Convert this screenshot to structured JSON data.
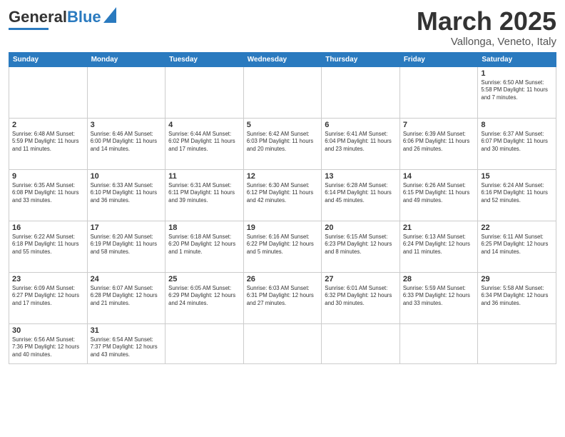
{
  "header": {
    "logo_general": "General",
    "logo_blue": "Blue",
    "month_title": "March 2025",
    "location": "Vallonga, Veneto, Italy"
  },
  "weekdays": [
    "Sunday",
    "Monday",
    "Tuesday",
    "Wednesday",
    "Thursday",
    "Friday",
    "Saturday"
  ],
  "days": [
    {
      "date": "",
      "info": ""
    },
    {
      "date": "",
      "info": ""
    },
    {
      "date": "",
      "info": ""
    },
    {
      "date": "",
      "info": ""
    },
    {
      "date": "",
      "info": ""
    },
    {
      "date": "",
      "info": ""
    },
    {
      "date": "1",
      "info": "Sunrise: 6:50 AM\nSunset: 5:58 PM\nDaylight: 11 hours\nand 7 minutes."
    },
    {
      "date": "2",
      "info": "Sunrise: 6:48 AM\nSunset: 5:59 PM\nDaylight: 11 hours\nand 11 minutes."
    },
    {
      "date": "3",
      "info": "Sunrise: 6:46 AM\nSunset: 6:00 PM\nDaylight: 11 hours\nand 14 minutes."
    },
    {
      "date": "4",
      "info": "Sunrise: 6:44 AM\nSunset: 6:02 PM\nDaylight: 11 hours\nand 17 minutes."
    },
    {
      "date": "5",
      "info": "Sunrise: 6:42 AM\nSunset: 6:03 PM\nDaylight: 11 hours\nand 20 minutes."
    },
    {
      "date": "6",
      "info": "Sunrise: 6:41 AM\nSunset: 6:04 PM\nDaylight: 11 hours\nand 23 minutes."
    },
    {
      "date": "7",
      "info": "Sunrise: 6:39 AM\nSunset: 6:06 PM\nDaylight: 11 hours\nand 26 minutes."
    },
    {
      "date": "8",
      "info": "Sunrise: 6:37 AM\nSunset: 6:07 PM\nDaylight: 11 hours\nand 30 minutes."
    },
    {
      "date": "9",
      "info": "Sunrise: 6:35 AM\nSunset: 6:08 PM\nDaylight: 11 hours\nand 33 minutes."
    },
    {
      "date": "10",
      "info": "Sunrise: 6:33 AM\nSunset: 6:10 PM\nDaylight: 11 hours\nand 36 minutes."
    },
    {
      "date": "11",
      "info": "Sunrise: 6:31 AM\nSunset: 6:11 PM\nDaylight: 11 hours\nand 39 minutes."
    },
    {
      "date": "12",
      "info": "Sunrise: 6:30 AM\nSunset: 6:12 PM\nDaylight: 11 hours\nand 42 minutes."
    },
    {
      "date": "13",
      "info": "Sunrise: 6:28 AM\nSunset: 6:14 PM\nDaylight: 11 hours\nand 45 minutes."
    },
    {
      "date": "14",
      "info": "Sunrise: 6:26 AM\nSunset: 6:15 PM\nDaylight: 11 hours\nand 49 minutes."
    },
    {
      "date": "15",
      "info": "Sunrise: 6:24 AM\nSunset: 6:16 PM\nDaylight: 11 hours\nand 52 minutes."
    },
    {
      "date": "16",
      "info": "Sunrise: 6:22 AM\nSunset: 6:18 PM\nDaylight: 11 hours\nand 55 minutes."
    },
    {
      "date": "17",
      "info": "Sunrise: 6:20 AM\nSunset: 6:19 PM\nDaylight: 11 hours\nand 58 minutes."
    },
    {
      "date": "18",
      "info": "Sunrise: 6:18 AM\nSunset: 6:20 PM\nDaylight: 12 hours\nand 1 minute."
    },
    {
      "date": "19",
      "info": "Sunrise: 6:16 AM\nSunset: 6:22 PM\nDaylight: 12 hours\nand 5 minutes."
    },
    {
      "date": "20",
      "info": "Sunrise: 6:15 AM\nSunset: 6:23 PM\nDaylight: 12 hours\nand 8 minutes."
    },
    {
      "date": "21",
      "info": "Sunrise: 6:13 AM\nSunset: 6:24 PM\nDaylight: 12 hours\nand 11 minutes."
    },
    {
      "date": "22",
      "info": "Sunrise: 6:11 AM\nSunset: 6:25 PM\nDaylight: 12 hours\nand 14 minutes."
    },
    {
      "date": "23",
      "info": "Sunrise: 6:09 AM\nSunset: 6:27 PM\nDaylight: 12 hours\nand 17 minutes."
    },
    {
      "date": "24",
      "info": "Sunrise: 6:07 AM\nSunset: 6:28 PM\nDaylight: 12 hours\nand 21 minutes."
    },
    {
      "date": "25",
      "info": "Sunrise: 6:05 AM\nSunset: 6:29 PM\nDaylight: 12 hours\nand 24 minutes."
    },
    {
      "date": "26",
      "info": "Sunrise: 6:03 AM\nSunset: 6:31 PM\nDaylight: 12 hours\nand 27 minutes."
    },
    {
      "date": "27",
      "info": "Sunrise: 6:01 AM\nSunset: 6:32 PM\nDaylight: 12 hours\nand 30 minutes."
    },
    {
      "date": "28",
      "info": "Sunrise: 5:59 AM\nSunset: 6:33 PM\nDaylight: 12 hours\nand 33 minutes."
    },
    {
      "date": "29",
      "info": "Sunrise: 5:58 AM\nSunset: 6:34 PM\nDaylight: 12 hours\nand 36 minutes."
    },
    {
      "date": "30",
      "info": "Sunrise: 6:56 AM\nSunset: 7:36 PM\nDaylight: 12 hours\nand 40 minutes."
    },
    {
      "date": "31",
      "info": "Sunrise: 6:54 AM\nSunset: 7:37 PM\nDaylight: 12 hours\nand 43 minutes."
    },
    {
      "date": "",
      "info": ""
    },
    {
      "date": "",
      "info": ""
    },
    {
      "date": "",
      "info": ""
    },
    {
      "date": "",
      "info": ""
    },
    {
      "date": "",
      "info": ""
    }
  ]
}
